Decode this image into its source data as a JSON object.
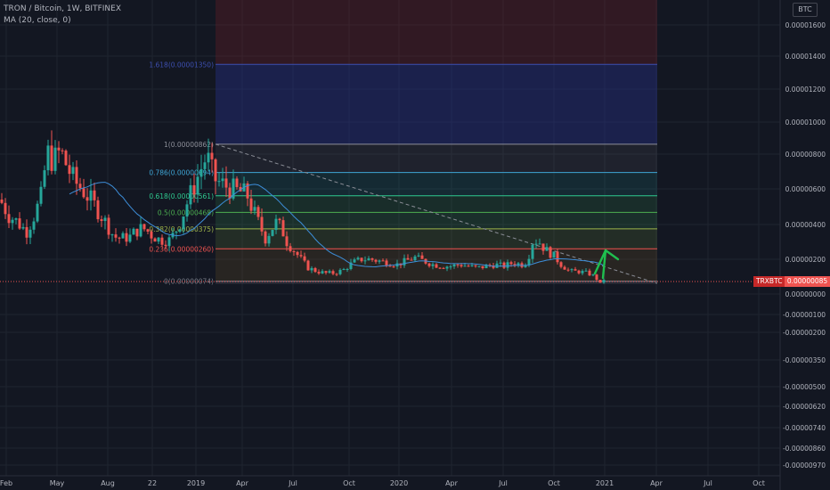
{
  "header": {
    "title": "TRON / Bitcoin, 1W, BITFINEX",
    "indicator": "MA (20, close, 0)"
  },
  "currency_badge": "BTC",
  "price_tag": {
    "symbol": "TRXBTC",
    "value": "0.00000085"
  },
  "colors": {
    "background": "#131722",
    "grid": "#1f2430",
    "up": "#26a69a",
    "down": "#ef5350",
    "ma": "#3d8ed9",
    "trend": "#8a8d96",
    "arrow": "#1fbf4f"
  },
  "chart_data": {
    "type": "candlestick",
    "x_tick_labels": [
      "Feb",
      "May",
      "Aug",
      "22",
      "2019",
      "Apr",
      "Jul",
      "Oct",
      "2020",
      "Apr",
      "Jul",
      "Oct",
      "2021",
      "Apr",
      "Jul",
      "Oct"
    ],
    "y_tick_labels": [
      "0.00001600",
      "0.00001400",
      "0.00001200",
      "0.00001000",
      "0.00000800",
      "0.00000600",
      "0.00000400",
      "0.00000200",
      "0.00000000",
      "-0.00000100",
      "-0.00000200",
      "-0.00000350",
      "-0.00000500",
      "-0.00000620",
      "-0.00000740",
      "-0.00000860",
      "-0.00000970"
    ],
    "fib_levels": [
      {
        "label": "1.618(0.00001350)",
        "ratio": 1.618,
        "value": 1.35e-05
      },
      {
        "label": "1(0.00000862)",
        "ratio": 1,
        "value": 8.62e-06
      },
      {
        "label": "0.786(0.00000694)",
        "ratio": 0.786,
        "value": 6.94e-06
      },
      {
        "label": "0.618(0.00000561)",
        "ratio": 0.618,
        "value": 5.61e-06
      },
      {
        "label": "0.5(0.00000468)",
        "ratio": 0.5,
        "value": 4.68e-06
      },
      {
        "label": "0.382(0.00000375)",
        "ratio": 0.382,
        "value": 3.75e-06
      },
      {
        "label": "0.236(0.00000260)",
        "ratio": 0.236,
        "value": 2.6e-06
      },
      {
        "label": "0(0.00000074)",
        "ratio": 0,
        "value": 7.4e-07
      }
    ],
    "series": [
      {
        "name": "TRXBTC",
        "kind": "candles",
        "close_path": [
          [
            0,
            5.4e-06
          ],
          [
            10,
            4.5e-06
          ],
          [
            18,
            4.2e-06
          ],
          [
            30,
            3.6e-06
          ],
          [
            40,
            4.7e-06
          ],
          [
            48,
            5.8e-06
          ],
          [
            52,
            8.2e-06
          ],
          [
            60,
            7.6e-06
          ],
          [
            68,
            8.2e-06
          ],
          [
            76,
            7.2e-06
          ],
          [
            84,
            6.4e-06
          ],
          [
            92,
            6e-06
          ],
          [
            100,
            5.5e-06
          ],
          [
            110,
            4.8e-06
          ],
          [
            120,
            4e-06
          ],
          [
            128,
            3.3e-06
          ],
          [
            136,
            3.2e-06
          ],
          [
            146,
            3.3e-06
          ],
          [
            152,
            3.6e-06
          ],
          [
            160,
            3.8e-06
          ],
          [
            166,
            3.6e-06
          ],
          [
            170,
            3.4e-06
          ],
          [
            180,
            3.1e-06
          ],
          [
            190,
            3.1e-06
          ],
          [
            196,
            3.5e-06
          ],
          [
            202,
            4.1e-06
          ],
          [
            210,
            5.2e-06
          ],
          [
            218,
            6.2e-06
          ],
          [
            226,
            7.2e-06
          ],
          [
            232,
            7.9e-06
          ],
          [
            236,
            7.3e-06
          ],
          [
            240,
            6.6e-06
          ],
          [
            248,
            6.3e-06
          ],
          [
            256,
            6.1e-06
          ],
          [
            264,
            5.9e-06
          ],
          [
            272,
            5.8e-06
          ],
          [
            278,
            5.6e-06
          ],
          [
            284,
            4.8e-06
          ],
          [
            292,
            3.9e-06
          ],
          [
            298,
            3.2e-06
          ],
          [
            304,
            3.7e-06
          ],
          [
            310,
            4.1e-06
          ],
          [
            316,
            3.8e-06
          ],
          [
            322,
            3e-06
          ],
          [
            330,
            2.5e-06
          ],
          [
            338,
            2e-06
          ],
          [
            346,
            1.5e-06
          ],
          [
            356,
            1.3e-06
          ],
          [
            366,
            1.2e-06
          ],
          [
            376,
            1.2e-06
          ],
          [
            386,
            1.4e-06
          ],
          [
            396,
            1.8e-06
          ],
          [
            406,
            2e-06
          ],
          [
            416,
            2e-06
          ],
          [
            426,
            1.9e-06
          ],
          [
            436,
            1.8e-06
          ],
          [
            446,
            1.7e-06
          ],
          [
            456,
            1.9e-06
          ],
          [
            466,
            2.1e-06
          ],
          [
            476,
            1.9e-06
          ],
          [
            486,
            1.7e-06
          ],
          [
            496,
            1.6e-06
          ],
          [
            506,
            1.6e-06
          ],
          [
            516,
            1.7e-06
          ],
          [
            526,
            1.6e-06
          ],
          [
            536,
            1.5e-06
          ],
          [
            546,
            1.6e-06
          ],
          [
            556,
            1.7e-06
          ],
          [
            566,
            1.6e-06
          ],
          [
            576,
            1.8e-06
          ],
          [
            586,
            1.7e-06
          ],
          [
            592,
            1.9e-06
          ],
          [
            598,
            3e-06
          ],
          [
            604,
            3.1e-06
          ],
          [
            610,
            2.7e-06
          ],
          [
            616,
            2.4e-06
          ],
          [
            622,
            2.2e-06
          ],
          [
            630,
            1.7e-06
          ],
          [
            640,
            1.3e-06
          ],
          [
            650,
            1.3e-06
          ],
          [
            660,
            1.2e-06
          ],
          [
            668,
            1e-06
          ],
          [
            674,
            6e-07
          ],
          [
            678,
            8.5e-07
          ]
        ]
      },
      {
        "name": "MA (20, close, 0)",
        "kind": "line"
      }
    ],
    "annotations": [
      "trend line from 1(0.00000862) to 0(0.00000074)",
      "upward green arrow"
    ],
    "grid": true,
    "yscale": "log"
  }
}
